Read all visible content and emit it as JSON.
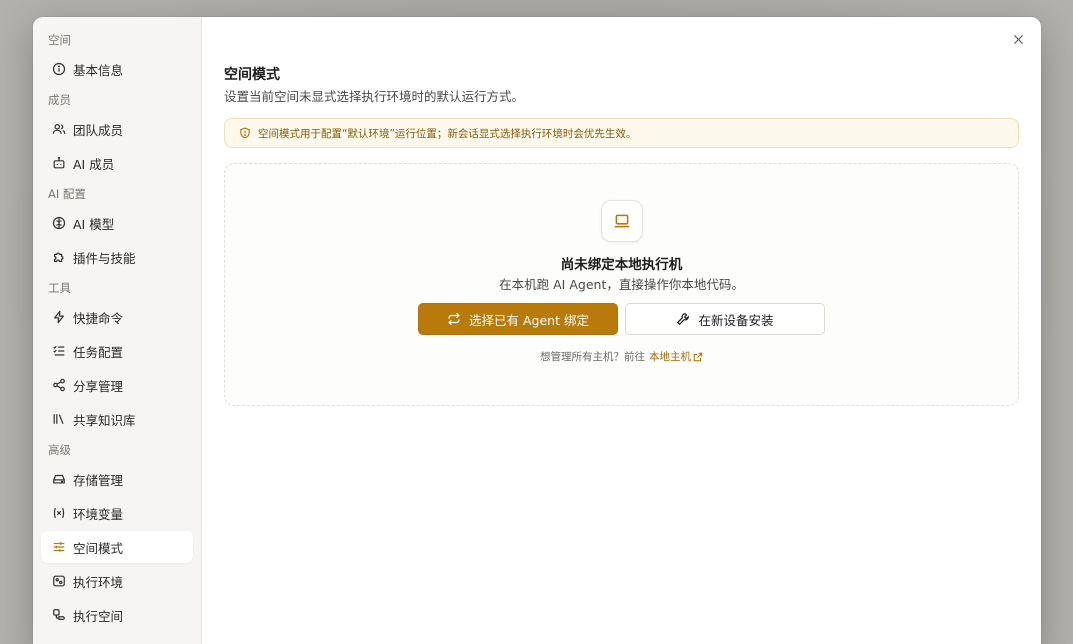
{
  "sidebar": {
    "groups": [
      {
        "title": "空间",
        "items": [
          {
            "label": "基本信息",
            "icon": "info-icon"
          }
        ]
      },
      {
        "title": "成员",
        "items": [
          {
            "label": "团队成员",
            "icon": "users-icon"
          },
          {
            "label": "AI 成员",
            "icon": "bot-icon"
          }
        ]
      },
      {
        "title": "AI 配置",
        "items": [
          {
            "label": "AI 模型",
            "icon": "brain-icon"
          },
          {
            "label": "插件与技能",
            "icon": "puzzle-icon"
          }
        ]
      },
      {
        "title": "工具",
        "items": [
          {
            "label": "快捷命令",
            "icon": "zap-icon"
          },
          {
            "label": "任务配置",
            "icon": "list-check-icon"
          },
          {
            "label": "分享管理",
            "icon": "share-icon"
          },
          {
            "label": "共享知识库",
            "icon": "library-icon"
          }
        ]
      },
      {
        "title": "高级",
        "items": [
          {
            "label": "存储管理",
            "icon": "hard-drive-icon"
          },
          {
            "label": "环境变量",
            "icon": "variable-icon"
          },
          {
            "label": "空间模式",
            "icon": "sliders-icon",
            "active": true
          },
          {
            "label": "执行环境",
            "icon": "server-icon"
          },
          {
            "label": "执行空间",
            "icon": "workspace-icon"
          }
        ]
      }
    ]
  },
  "main": {
    "title": "空间模式",
    "subtitle": "设置当前空间未显式选择执行环境时的默认运行方式。",
    "alert": "空间模式用于配置“默认环境”运行位置；新会话显式选择执行环境时会优先生效。",
    "empty": {
      "title": "尚未绑定本地执行机",
      "description": "在本机跑 AI Agent，直接操作你本地代码。",
      "primary_button": "选择已有 Agent 绑定",
      "secondary_button": "在新设备安装",
      "footnote_prefix": "想管理所有主机？前往",
      "footnote_link": "本地主机"
    }
  },
  "colors": {
    "accent": "#b87a0a",
    "alert_bg": "#fdf8ec",
    "alert_border": "#f1dfb6"
  }
}
